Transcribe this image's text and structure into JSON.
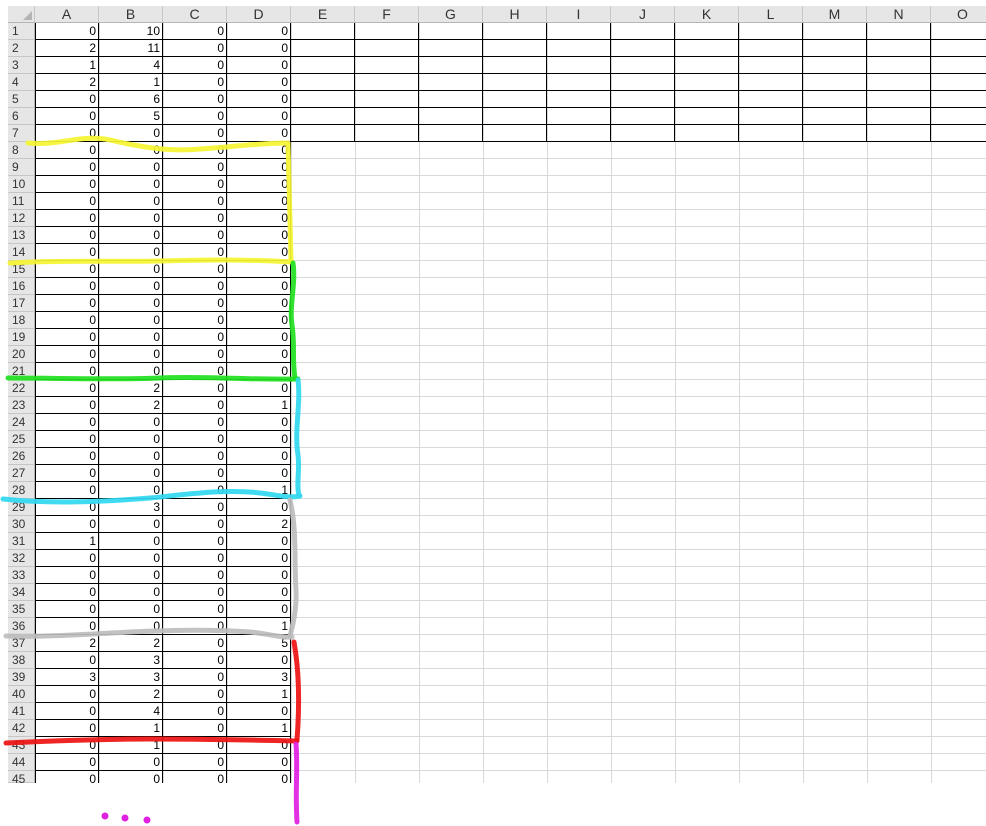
{
  "sheet": {
    "columns": [
      "A",
      "B",
      "C",
      "D",
      "E",
      "F",
      "G",
      "H",
      "I",
      "J",
      "K",
      "L",
      "M",
      "N",
      "O"
    ],
    "rows": [
      {
        "row": "1",
        "values": [
          "0",
          "10",
          "0",
          "0"
        ]
      },
      {
        "row": "2",
        "values": [
          "2",
          "11",
          "0",
          "0"
        ]
      },
      {
        "row": "3",
        "values": [
          "1",
          "4",
          "0",
          "0"
        ]
      },
      {
        "row": "4",
        "values": [
          "2",
          "1",
          "0",
          "0"
        ]
      },
      {
        "row": "5",
        "values": [
          "0",
          "6",
          "0",
          "0"
        ]
      },
      {
        "row": "6",
        "values": [
          "0",
          "5",
          "0",
          "0"
        ]
      },
      {
        "row": "7",
        "values": [
          "0",
          "0",
          "0",
          "0"
        ]
      },
      {
        "row": "8",
        "values": [
          "0",
          "0",
          "0",
          "0"
        ]
      },
      {
        "row": "9",
        "values": [
          "0",
          "0",
          "0",
          "0"
        ]
      },
      {
        "row": "10",
        "values": [
          "0",
          "0",
          "0",
          "0"
        ]
      },
      {
        "row": "11",
        "values": [
          "0",
          "0",
          "0",
          "0"
        ]
      },
      {
        "row": "12",
        "values": [
          "0",
          "0",
          "0",
          "0"
        ]
      },
      {
        "row": "13",
        "values": [
          "0",
          "0",
          "0",
          "0"
        ]
      },
      {
        "row": "14",
        "values": [
          "0",
          "0",
          "0",
          "0"
        ]
      },
      {
        "row": "15",
        "values": [
          "0",
          "0",
          "0",
          "0"
        ]
      },
      {
        "row": "16",
        "values": [
          "0",
          "0",
          "0",
          "0"
        ]
      },
      {
        "row": "17",
        "values": [
          "0",
          "0",
          "0",
          "0"
        ]
      },
      {
        "row": "18",
        "values": [
          "0",
          "0",
          "0",
          "0"
        ]
      },
      {
        "row": "19",
        "values": [
          "0",
          "0",
          "0",
          "0"
        ]
      },
      {
        "row": "20",
        "values": [
          "0",
          "0",
          "0",
          "0"
        ]
      },
      {
        "row": "21",
        "values": [
          "0",
          "0",
          "0",
          "0"
        ]
      },
      {
        "row": "22",
        "values": [
          "0",
          "2",
          "0",
          "0"
        ]
      },
      {
        "row": "23",
        "values": [
          "0",
          "2",
          "0",
          "1"
        ]
      },
      {
        "row": "24",
        "values": [
          "0",
          "0",
          "0",
          "0"
        ]
      },
      {
        "row": "25",
        "values": [
          "0",
          "0",
          "0",
          "0"
        ]
      },
      {
        "row": "26",
        "values": [
          "0",
          "0",
          "0",
          "0"
        ]
      },
      {
        "row": "27",
        "values": [
          "0",
          "0",
          "0",
          "0"
        ]
      },
      {
        "row": "28",
        "values": [
          "0",
          "0",
          "0",
          "1"
        ]
      },
      {
        "row": "29",
        "values": [
          "0",
          "3",
          "0",
          "0"
        ]
      },
      {
        "row": "30",
        "values": [
          "0",
          "0",
          "0",
          "2"
        ]
      },
      {
        "row": "31",
        "values": [
          "1",
          "0",
          "0",
          "0"
        ]
      },
      {
        "row": "32",
        "values": [
          "0",
          "0",
          "0",
          "0"
        ]
      },
      {
        "row": "33",
        "values": [
          "0",
          "0",
          "0",
          "0"
        ]
      },
      {
        "row": "34",
        "values": [
          "0",
          "0",
          "0",
          "0"
        ]
      },
      {
        "row": "35",
        "values": [
          "0",
          "0",
          "0",
          "0"
        ]
      },
      {
        "row": "36",
        "values": [
          "0",
          "0",
          "0",
          "1"
        ]
      },
      {
        "row": "37",
        "values": [
          "2",
          "2",
          "0",
          "5"
        ]
      },
      {
        "row": "38",
        "values": [
          "0",
          "3",
          "0",
          "0"
        ]
      },
      {
        "row": "39",
        "values": [
          "3",
          "3",
          "0",
          "3"
        ]
      },
      {
        "row": "40",
        "values": [
          "0",
          "2",
          "0",
          "1"
        ]
      },
      {
        "row": "41",
        "values": [
          "0",
          "4",
          "0",
          "0"
        ]
      },
      {
        "row": "42",
        "values": [
          "0",
          "1",
          "0",
          "1"
        ]
      },
      {
        "row": "43",
        "values": [
          "0",
          "1",
          "0",
          "0"
        ]
      },
      {
        "row": "44",
        "values": [
          "0",
          "0",
          "0",
          "0"
        ]
      },
      {
        "row": "45",
        "values": [
          "0",
          "0",
          "0",
          "0"
        ]
      }
    ]
  },
  "annotations": {
    "groups": [
      {
        "label": "rows 8-14",
        "color": "#f5f532"
      },
      {
        "label": "rows 15-21",
        "color": "#20e020"
      },
      {
        "label": "rows 22-28",
        "color": "#30d8f0"
      },
      {
        "label": "rows 29-36",
        "color": "#bdbdbd"
      },
      {
        "label": "rows 37-42",
        "color": "#ee1111"
      },
      {
        "label": "rows 43-45",
        "color": "#e020e0"
      }
    ]
  },
  "colors": {
    "header_bg": "#e6e6e6",
    "gridline": "#d9d9d9",
    "border": "#000000"
  }
}
